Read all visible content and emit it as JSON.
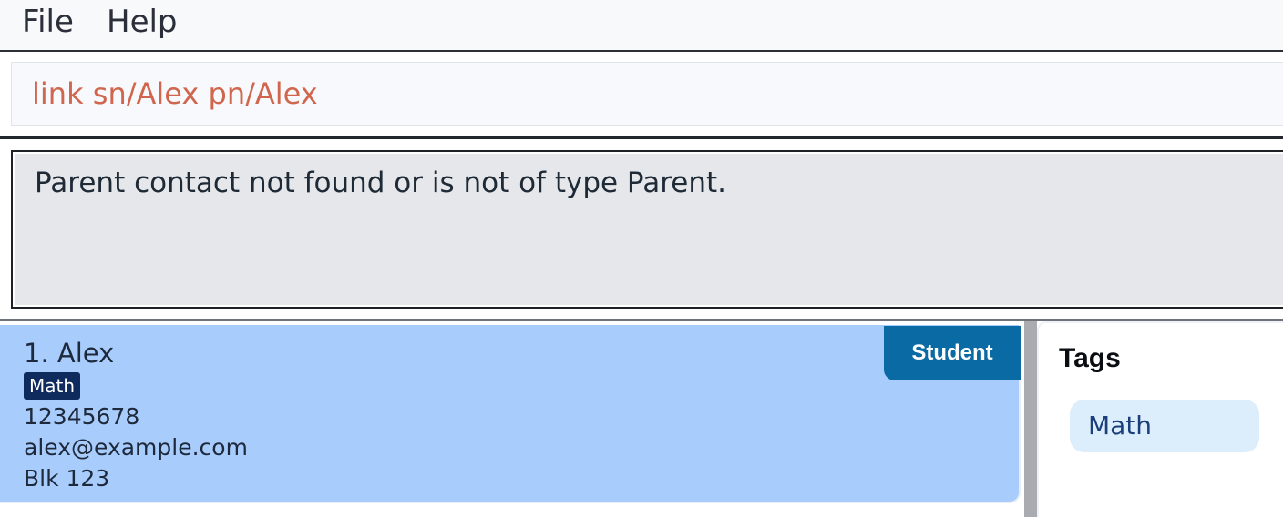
{
  "menu": {
    "file": "File",
    "help": "Help"
  },
  "command": {
    "value": "link sn/Alex pn/Alex"
  },
  "result": {
    "message": "Parent contact not found or is not of type Parent."
  },
  "persons": [
    {
      "name": "1. Alex",
      "tag": "Math",
      "phone": "12345678",
      "email": "alex@example.com",
      "address": "Blk 123",
      "type": "Student"
    }
  ],
  "tags_panel": {
    "title": "Tags",
    "items": [
      "Math"
    ]
  },
  "colors": {
    "command_text": "#d0664d",
    "card_background": "#a8cdfd",
    "type_badge": "#0a6aa3",
    "tag_chip": "#0f2a5c",
    "tag_pill": "#dcedfc"
  }
}
